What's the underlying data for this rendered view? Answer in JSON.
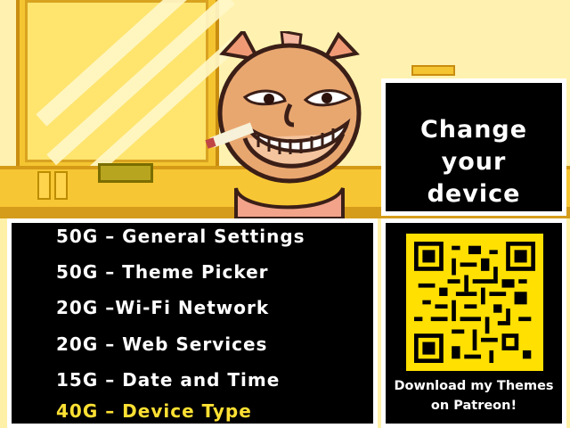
{
  "scene": {
    "character": "grinning-cat-character",
    "accent_color": "#ffe033",
    "background_color": "#fff2b0"
  },
  "header": {
    "title_line1": "Change your",
    "title_line2": "device"
  },
  "menu": {
    "items": [
      {
        "label": "50G – General Settings",
        "active": false
      },
      {
        "label": "50G – Theme Picker",
        "active": false
      },
      {
        "label": "20G –Wi-Fi Network",
        "active": false
      },
      {
        "label": "20G – Web Services",
        "active": false
      },
      {
        "label": "15G – Date and Time",
        "active": false
      },
      {
        "label": "40G – Device Type",
        "active": true
      }
    ]
  },
  "promo": {
    "qr_icon": "qr-code-icon",
    "line1": "Download my Themes",
    "line2": "on Patreon!"
  }
}
